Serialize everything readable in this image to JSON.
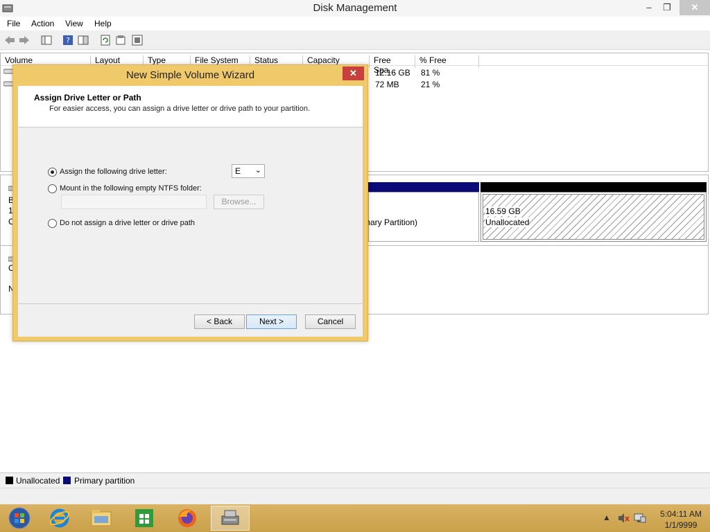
{
  "window": {
    "title": "Disk Management",
    "min": "–",
    "max": "❐",
    "close": "✕"
  },
  "menu": [
    "File",
    "Action",
    "View",
    "Help"
  ],
  "columns": [
    "Volume",
    "Layout",
    "Type",
    "File System",
    "Status",
    "Capacity",
    "Free Spa...",
    "% Free"
  ],
  "volumes": [
    {
      "free": "12.16 GB",
      "pct": "81 %"
    },
    {
      "free": "72 MB",
      "pct": "21 %"
    }
  ],
  "disk": {
    "left_fragments": [
      "B",
      "1:",
      "O",
      "C",
      "N"
    ],
    "partition_label": "mary Partition)",
    "unalloc_size": "16.59 GB",
    "unalloc_label": "Unallocated"
  },
  "legend": [
    {
      "label": "Unallocated",
      "color": "#000000"
    },
    {
      "label": "Primary partition",
      "color": "#0a0a78"
    }
  ],
  "wizard": {
    "title": "New Simple Volume Wizard",
    "close": "✕",
    "heading": "Assign Drive Letter or Path",
    "subheading": "For easier access, you can assign a drive letter or drive path to your partition.",
    "option_assign": "Assign the following drive letter:",
    "option_mount": "Mount in the following empty NTFS folder:",
    "option_none": "Do not assign a drive letter or drive path",
    "drive_letter": "E",
    "browse": "Browse...",
    "back": "< Back",
    "next": "Next >",
    "cancel": "Cancel"
  },
  "taskbar": {
    "time": "5:04:11 AM",
    "date": "1/1/9999",
    "tray_up": "▲"
  },
  "colors": {
    "primary": "#0a0a78",
    "taskbar": "#d4ab58",
    "dialog_border": "#f0c96a"
  }
}
